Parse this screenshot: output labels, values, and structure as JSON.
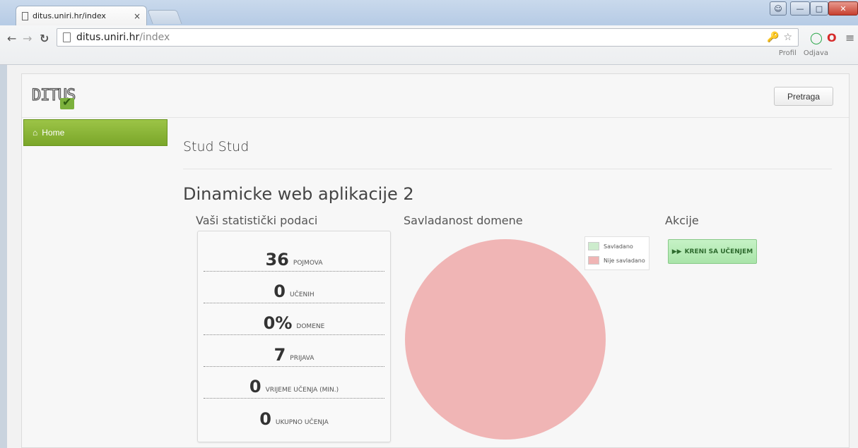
{
  "browser": {
    "tab_title": "ditus.uniri.hr/index",
    "tab_close": "×",
    "url_host": "ditus.uniri.hr",
    "url_path": "/index",
    "icons": [
      "page-icon",
      "key-icon",
      "star-icon",
      "chrome-extension-icon",
      "opera-icon",
      "extension-icon",
      "menu-icon"
    ]
  },
  "site": {
    "logo_text": "DITUS",
    "top_links": {
      "profile": "Profil",
      "logout": "Odjava"
    },
    "search_button": "Pretraga",
    "sidebar": {
      "home_label": "Home"
    }
  },
  "main": {
    "user_name": "Stud Stud",
    "course_title": "Dinamicke web aplikacije 2",
    "stats": {
      "heading": "Vaši statistički podaci",
      "rows": [
        {
          "value": "36",
          "label": "POJMOVA"
        },
        {
          "value": "0",
          "label": "UČENIH"
        },
        {
          "value": "0%",
          "label": "DOMENE"
        },
        {
          "value": "7",
          "label": "PRIJAVA"
        },
        {
          "value": "0",
          "label": "VRIJEME UČENJA (MIN.)"
        },
        {
          "value": "0",
          "label": "UKUPNO UČENJA"
        }
      ]
    },
    "chart": {
      "heading": "Savladanost domene",
      "legend": [
        {
          "label": "Savladano",
          "color": "#cdeccd"
        },
        {
          "label": "Nije savladano",
          "color": "#f0b5b5"
        }
      ]
    },
    "actions": {
      "heading": "Akcije",
      "start_button": "KRENI SA UČENJEM",
      "start_icon": "fast-forward-icon"
    }
  },
  "chart_data": {
    "type": "pie",
    "categories": [
      "Savladano",
      "Nije savladano"
    ],
    "values": [
      0,
      100
    ],
    "colors": [
      "#cdeccd",
      "#f0b5b5"
    ],
    "title": "Savladanost domene",
    "legend_position": "top-right"
  }
}
